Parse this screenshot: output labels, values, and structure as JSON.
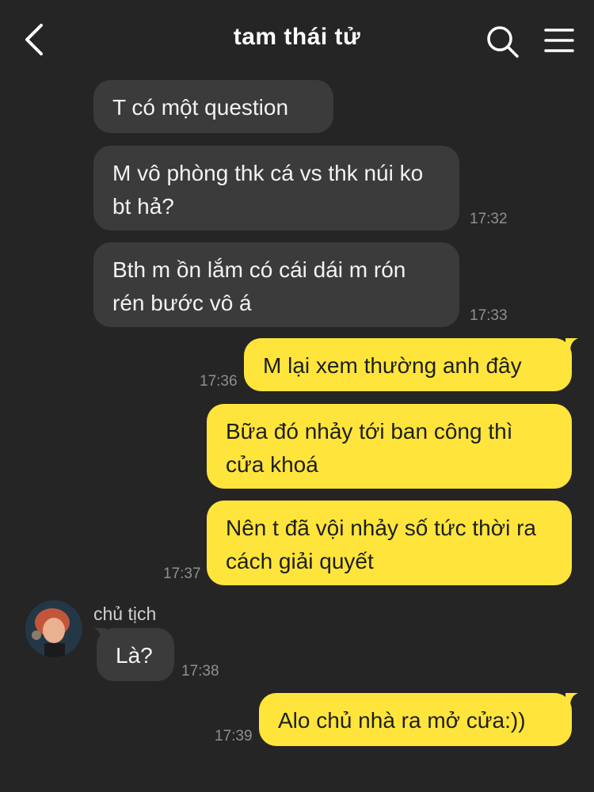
{
  "header": {
    "title": "tam thái tử"
  },
  "messages": [
    {
      "text": "T có một question",
      "time": ""
    },
    {
      "text": "M vô phòng thk cá vs thk núi ko bt hả?",
      "time": "17:32"
    },
    {
      "text": "Bth m ồn lắm có cái dái m rón rén bước vô á",
      "time": "17:33"
    },
    {
      "text": "M lại xem thường anh đây",
      "time": "17:36"
    },
    {
      "text": "Bữa đó nhảy tới ban công thì cửa khoá",
      "time": ""
    },
    {
      "text": "Nên t đã vội nhảy số tức thời ra cách giải quyết",
      "time": "17:37"
    },
    {
      "sender": "chủ tịch",
      "text": "Là?",
      "time": "17:38"
    },
    {
      "text": "Alo chủ nhà ra mở cửa:))",
      "time": "17:39"
    }
  ]
}
